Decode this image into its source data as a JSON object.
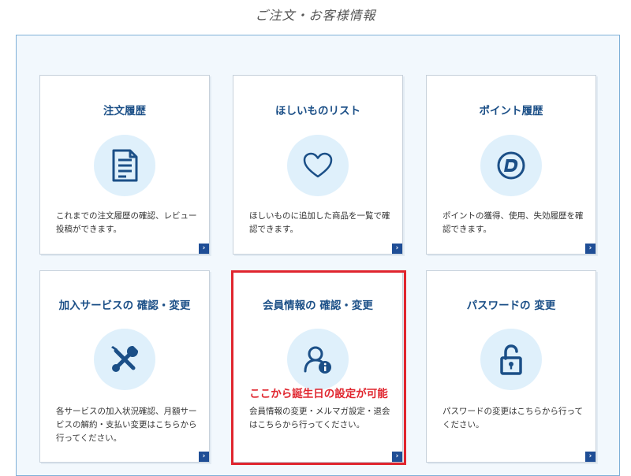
{
  "page": {
    "title": "ご注文・お客様情報"
  },
  "cards": [
    {
      "title": "注文履歴",
      "icon": "document-icon",
      "desc": "これまでの注文履歴の確認、レビュー投稿ができます。"
    },
    {
      "title": "ほしいものリスト",
      "icon": "heart-icon",
      "desc": "ほしいものに追加した商品を一覧で確認できます。"
    },
    {
      "title": "ポイント履歴",
      "icon": "point-d-icon",
      "desc": "ポイントの獲得、使用、失効履歴を確認できます。"
    },
    {
      "title": "加入サービスの 確認・変更",
      "icon": "tools-icon",
      "desc": "各サービスの加入状況確認、月額サービスの解約・支払い変更はこちらから行ってください。"
    },
    {
      "title": "会員情報の 確認・変更",
      "icon": "user-info-icon",
      "desc": "会員情報の変更・メルマガ設定・退会はこちらから行ってください。"
    },
    {
      "title": "パスワードの 変更",
      "icon": "unlock-icon",
      "desc": "パスワードの変更はこちらから行ってください。"
    }
  ],
  "annotation": {
    "note": "ここから誕生日の設定が可能"
  },
  "arrow_glyph": "›",
  "colors": {
    "accent": "#1b4f87",
    "icon_bg": "#dff0fb",
    "highlight": "#e0252e",
    "arrow_bg": "#1f4e96"
  }
}
